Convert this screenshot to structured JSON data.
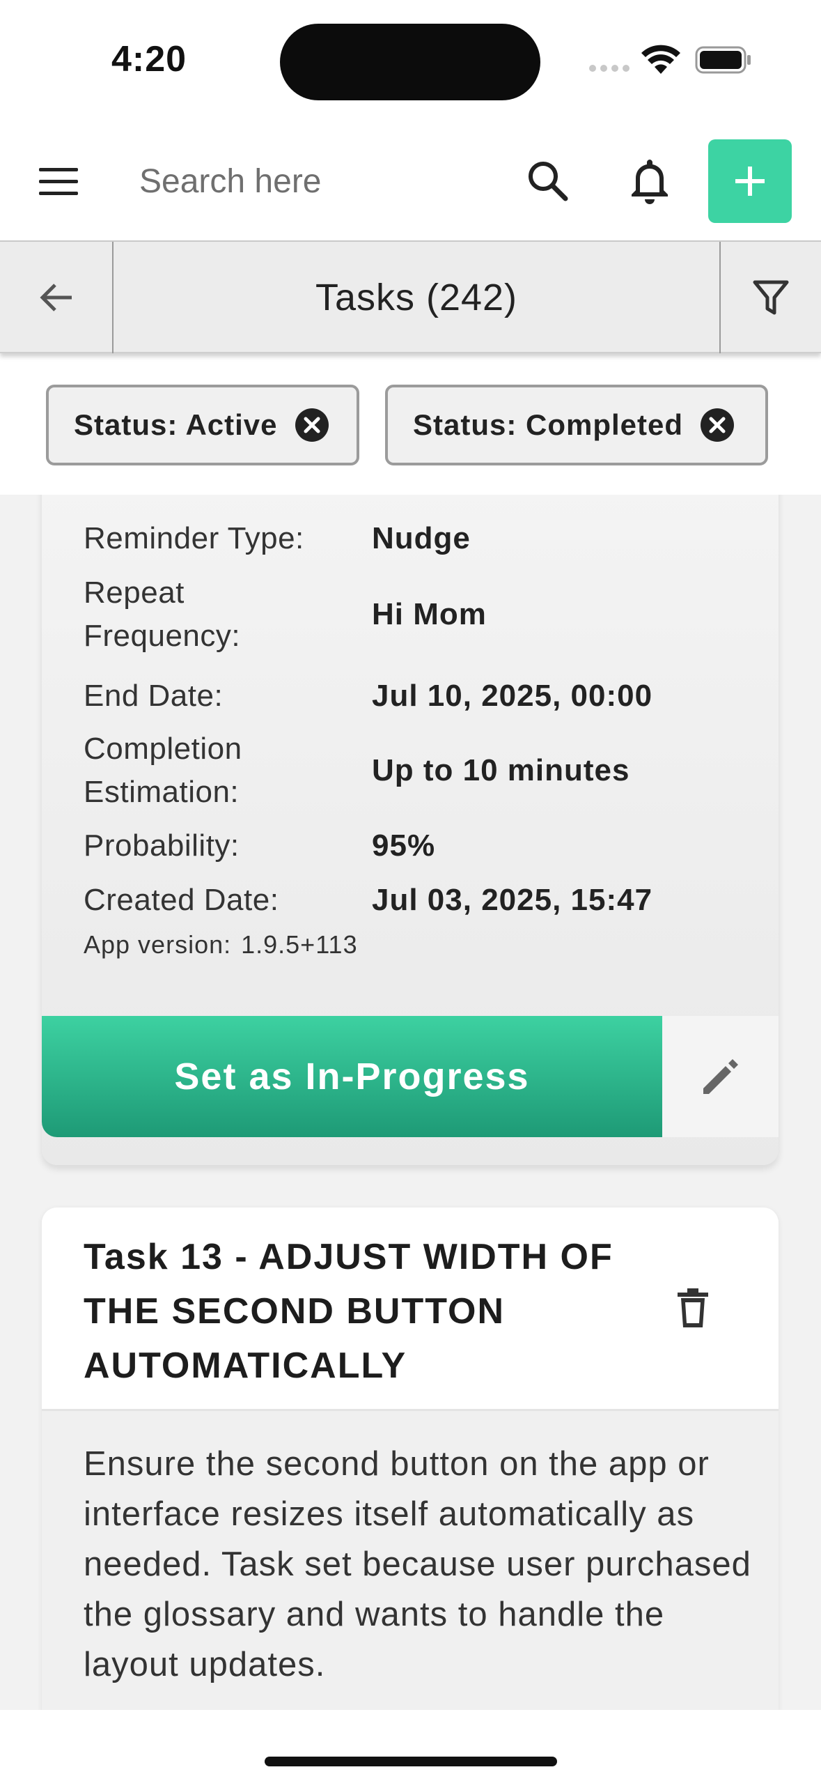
{
  "status_bar": {
    "time": "4:20"
  },
  "header": {
    "search_placeholder": "Search here"
  },
  "tasks_bar": {
    "title": "Tasks (242)"
  },
  "filters": [
    {
      "label": "Status: Active"
    },
    {
      "label": "Status: Completed"
    }
  ],
  "task_detail": {
    "rows": [
      {
        "label": "Reminder Type:",
        "value": "Nudge"
      },
      {
        "label": "Repeat Frequency:",
        "value": "Hi Mom"
      },
      {
        "label": "End Date:",
        "value": "Jul 10, 2025, 00:00"
      },
      {
        "label": "Completion Estimation:",
        "value": "Up to 10 minutes"
      },
      {
        "label": "Probability:",
        "value": "95%"
      },
      {
        "label": "Created Date:",
        "value": "Jul 03, 2025, 15:47"
      }
    ],
    "app_version_label": "App version:",
    "app_version_value": "1.9.5+113",
    "primary_action": "Set as In-Progress"
  },
  "next_task": {
    "title": "Task 13 - ADJUST WIDTH OF THE SECOND BUTTON AUTOMATICALLY",
    "description": "Ensure the second button on the app or interface resizes itself automatically as needed. Task set because user purchased the glossary and wants to handle the layout updates."
  },
  "colors": {
    "accent": "#3dd3a3",
    "accent_dark": "#1e9a76",
    "chip_border": "#9b9b9b",
    "bar_bg": "#ececec"
  }
}
